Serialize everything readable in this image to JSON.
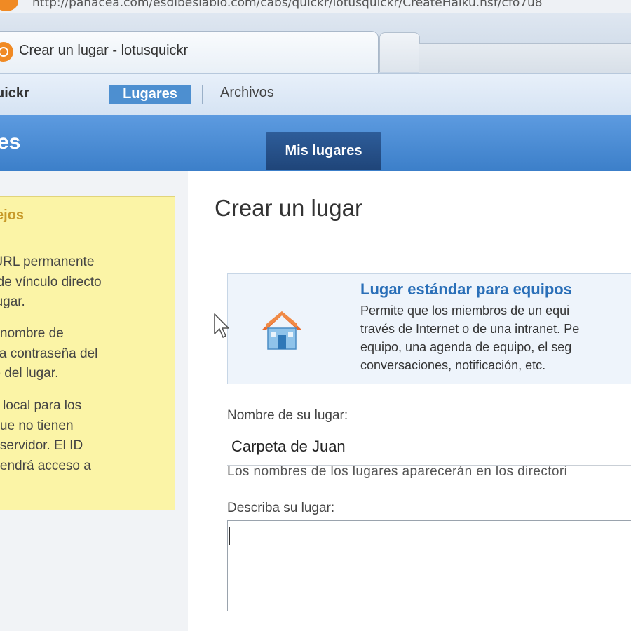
{
  "browser": {
    "url": "http://panacea.com/esdibeslablo.com/cabs/quickr/lotusquickr/CreateHaiku.nsf/cfo7u8",
    "tab_title": "Crear un lugar - lotusquickr"
  },
  "app": {
    "name": "uickr",
    "nav": {
      "lugares": "Lugares",
      "archivos": "Archivos"
    },
    "section_title": "es",
    "tab_mis_lugares": "Mis lugares"
  },
  "tips": {
    "title": "ejos",
    "items": [
      "na URL permanente\nrva de vínculo directo\nvo lugar.",
      "a el nombre de\no y la contraseña del\ntario del lugar.",
      "n ID local para los\nos que no tienen\no al servidor. El ID\nólo tendrá acceso a\ngar."
    ]
  },
  "main": {
    "title": "Crear un lugar",
    "template": {
      "icon": "house-icon",
      "name": "Lugar estándar para equipos",
      "description": "Permite que los miembros de un equi\ntravés de Internet o de una intranet. Pe\nequipo, una agenda de equipo, el seg\nconversaciones, notificación, etc."
    },
    "form": {
      "name_label": "Nombre de su lugar:",
      "name_value": "Carpeta de Juan",
      "name_hint": "Los nombres de los lugares aparecerán en los directori",
      "description_label": "Describa su lugar:",
      "description_value": ""
    }
  },
  "colors": {
    "accent": "#4d8fd0",
    "header_blue": "#3c7fc9",
    "tips_background": "#fbf4a6",
    "link_blue": "#2a6fb8"
  }
}
